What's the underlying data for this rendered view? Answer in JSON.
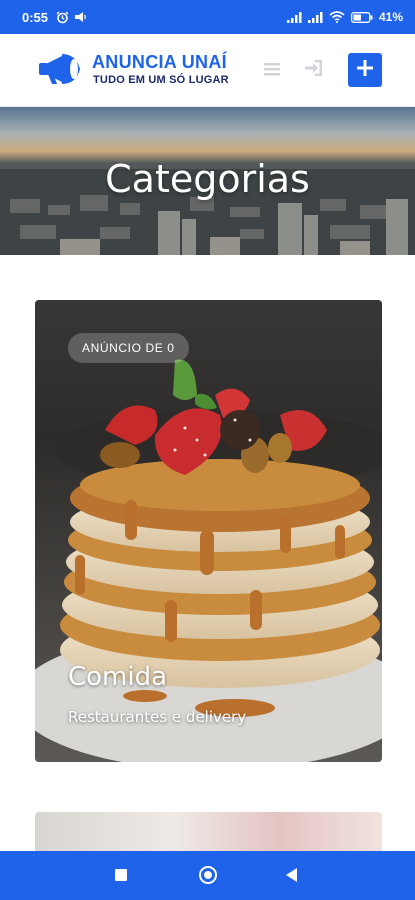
{
  "status_bar": {
    "time": "0:55",
    "left_icons": [
      "alarm-icon",
      "cast-icon"
    ],
    "right_icons": [
      "signal-icon",
      "signal-icon",
      "wifi-icon",
      "battery-icon"
    ],
    "battery": "41%"
  },
  "header": {
    "brand_name": "ANUNCIA UNAÍ",
    "brand_tagline": "TUDO EM UM SÓ LUGAR",
    "logo_icon": "megaphone-icon",
    "menu_icon": "menu-icon",
    "login_icon": "sign-in-icon",
    "add_icon": "plus-icon",
    "brand_color": "#1e63e9"
  },
  "hero": {
    "title": "Categorias"
  },
  "categories": [
    {
      "badge": "ANÚNCIO DE 0",
      "title": "Comida",
      "subtitle": "Restaurantes e delivery"
    }
  ],
  "nav_bar": {
    "buttons": [
      "recents-button",
      "home-button",
      "back-button"
    ],
    "color": "#1e63e9"
  }
}
